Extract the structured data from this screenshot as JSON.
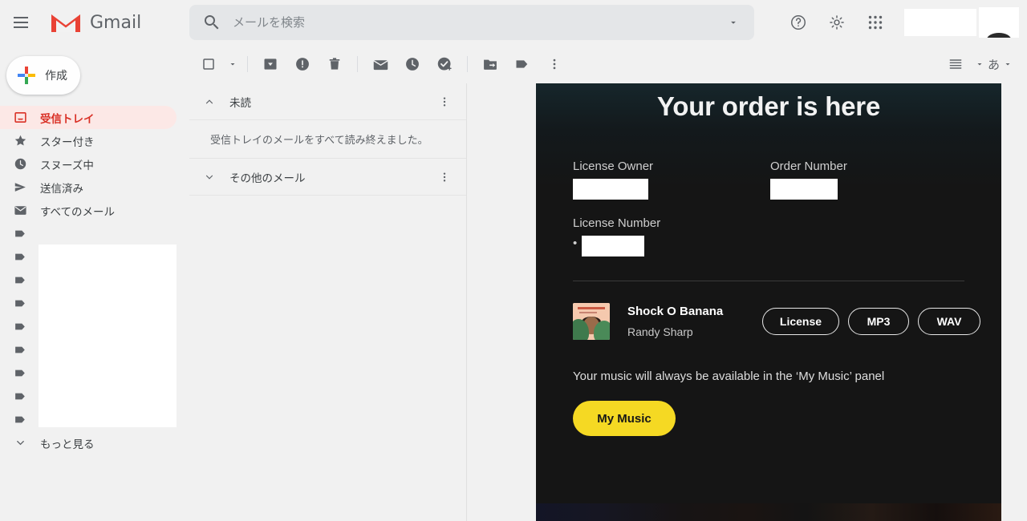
{
  "header": {
    "menu_icon": "hamburger-menu-icon",
    "logo_icon": "gmail-logo-icon",
    "brand": "Gmail",
    "search": {
      "icon": "search-icon",
      "placeholder": "メールを検索",
      "value": "",
      "options_icon": "chevron-down-icon"
    },
    "help_icon": "help-circle-icon",
    "settings_icon": "gear-icon",
    "apps_icon": "apps-grid-icon",
    "account_redacted": true
  },
  "sidebar": {
    "compose": {
      "label": "作成",
      "icon": "plus-icon"
    },
    "items": [
      {
        "label": "受信トレイ",
        "icon": "inbox-icon",
        "active": true
      },
      {
        "label": "スター付き",
        "icon": "star-icon",
        "active": false
      },
      {
        "label": "スヌーズ中",
        "icon": "clock-icon",
        "active": false
      },
      {
        "label": "送信済み",
        "icon": "send-icon",
        "active": false
      },
      {
        "label": "すべてのメール",
        "icon": "mail-icon",
        "active": false
      },
      {
        "label": "",
        "icon": "label-icon",
        "active": false
      },
      {
        "label": "",
        "icon": "label-icon",
        "active": false
      },
      {
        "label": "",
        "icon": "label-icon",
        "active": false
      },
      {
        "label": "",
        "icon": "label-icon",
        "active": false
      },
      {
        "label": "",
        "icon": "label-icon",
        "active": false
      },
      {
        "label": "",
        "icon": "label-icon",
        "active": false
      },
      {
        "label": "",
        "icon": "label-icon",
        "active": false
      },
      {
        "label": "",
        "icon": "label-icon",
        "active": false
      },
      {
        "label": "",
        "icon": "label-icon",
        "active": false
      }
    ],
    "more": {
      "label": "もっと見る",
      "icon": "chevron-down-icon"
    }
  },
  "toolbar": {
    "select_all": "checkbox-icon",
    "select_caret": "chevron-down-icon",
    "archive": "archive-icon",
    "report_spam": "report-spam-icon",
    "delete": "trash-icon",
    "mark_unread": "mark-as-unread-icon",
    "snooze": "clock-icon",
    "add_to_tasks": "add-to-tasks-icon",
    "move_to": "move-to-folder-icon",
    "labels": "label-icon",
    "more": "more-vertical-icon",
    "density": "list-density-icon",
    "density_caret": "chevron-down-icon",
    "ime_label": "あ",
    "ime_caret": "chevron-down-icon"
  },
  "list": {
    "sections": [
      {
        "title": "未読",
        "chevron": "chevron-up-icon",
        "more": "more-vertical-icon"
      },
      {
        "title": "その他のメール",
        "chevron": "chevron-down-icon",
        "more": "more-vertical-icon"
      }
    ],
    "empty_message": "受信トレイのメールをすべて読み終えました。"
  },
  "email": {
    "title": "Your order is here",
    "fields": [
      {
        "label": "License Owner",
        "value": "",
        "redacted": true
      },
      {
        "label": "Order Number",
        "value": "",
        "redacted": true
      },
      {
        "label": "License Number",
        "value": "",
        "redacted": true
      }
    ],
    "track": {
      "artwork": "album-artwork",
      "name": "Shock O Banana",
      "artist": "Randy Sharp",
      "buttons": [
        {
          "label": "License"
        },
        {
          "label": "MP3"
        },
        {
          "label": "WAV"
        }
      ]
    },
    "footnote": "Your music will always be available in the ‘My Music’ panel",
    "cta": {
      "label": "My Music"
    }
  },
  "colors": {
    "gmail_red": "#d93025",
    "active_bg": "#fce8e6",
    "page_bg": "#f1f1f1",
    "mail_bg": "#151515",
    "cta_yellow": "#f5d923"
  }
}
